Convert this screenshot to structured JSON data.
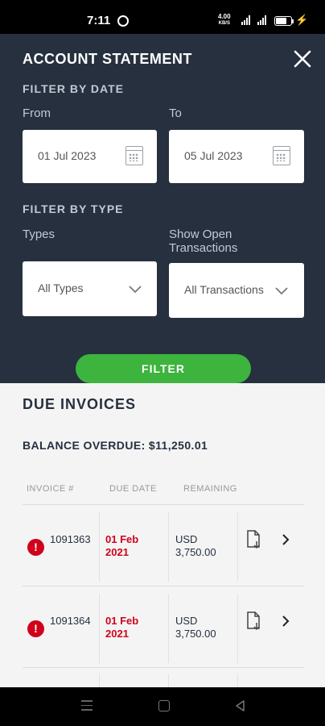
{
  "status_bar": {
    "time": "7:11",
    "net_speed": "4.00",
    "net_unit": "KB/S",
    "network_type": "LTE",
    "battery_level": 0.7
  },
  "header": {
    "title": "ACCOUNT STATEMENT",
    "close_icon": "close-icon"
  },
  "filter_by_date": {
    "section_title": "FILTER BY DATE",
    "from": {
      "label": "From",
      "value": "01 Jul 2023"
    },
    "to": {
      "label": "To",
      "value": "05 Jul 2023"
    }
  },
  "filter_by_type": {
    "section_title": "FILTER BY TYPE",
    "types": {
      "label": "Types",
      "value": "All Types"
    },
    "open_transactions": {
      "label": "Show Open Transactions",
      "value": "All Transactions"
    }
  },
  "filter_button": {
    "label": "FILTER"
  },
  "due_invoices": {
    "title": "DUE INVOICES",
    "balance_overdue": "BALANCE OVERDUE: $11,250.01",
    "columns": [
      "INVOICE #",
      "DUE DATE",
      "REMAINING"
    ],
    "rows": [
      {
        "invoice": "1091363",
        "due_date": "01 Feb 2021",
        "remaining": "USD 3,750.00"
      },
      {
        "invoice": "1091364",
        "due_date": "01 Feb 2021",
        "remaining": "USD 3,750.00"
      }
    ]
  },
  "colors": {
    "panel_bg": "#26303e",
    "accent_green": "#3db43d",
    "overdue_red": "#d0021b"
  }
}
